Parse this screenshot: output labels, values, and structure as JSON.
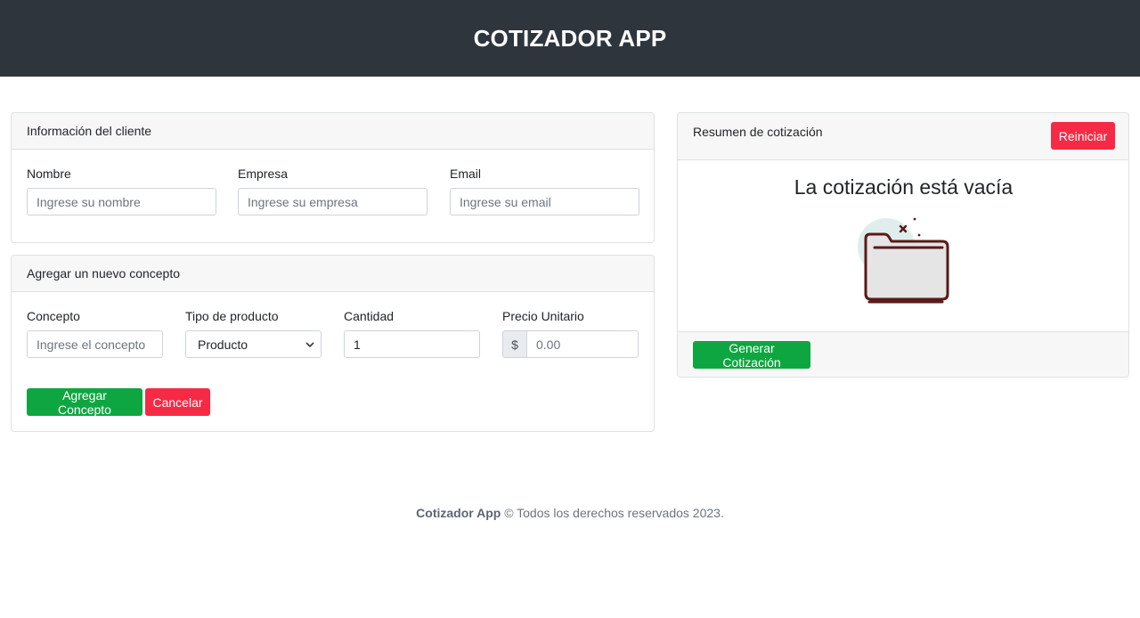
{
  "header": {
    "title": "COTIZADOR APP"
  },
  "client_card": {
    "title": "Información del cliente",
    "fields": [
      {
        "label": "Nombre",
        "placeholder": "Ingrese su nombre",
        "value": ""
      },
      {
        "label": "Empresa",
        "placeholder": "Ingrese su empresa",
        "value": ""
      },
      {
        "label": "Email",
        "placeholder": "Ingrese su email",
        "value": ""
      }
    ]
  },
  "concept_card": {
    "title": "Agregar un nuevo concepto",
    "concept": {
      "label": "Concepto",
      "placeholder": "Ingrese el concepto"
    },
    "product_type": {
      "label": "Tipo de producto",
      "selected": "Producto"
    },
    "quantity": {
      "label": "Cantidad",
      "value": "1"
    },
    "unit_price": {
      "label": "Precio Unitario",
      "prefix": "$",
      "placeholder": "0.00"
    },
    "add_button": "Agregar Concepto",
    "cancel_button": "Cancelar"
  },
  "summary_card": {
    "title": "Resumen de cotización",
    "reset_button": "Reiniciar",
    "empty_message": "La cotización está vacía",
    "empty_icon": "empty-folder-icon",
    "generate_button": "Generar Cotización"
  },
  "footer": {
    "brand": "Cotizador App",
    "text": "© Todos los derechos reservados 2023."
  },
  "colors": {
    "header_bg": "#2e353d",
    "success": "#0ea640",
    "danger": "#f62a44"
  }
}
